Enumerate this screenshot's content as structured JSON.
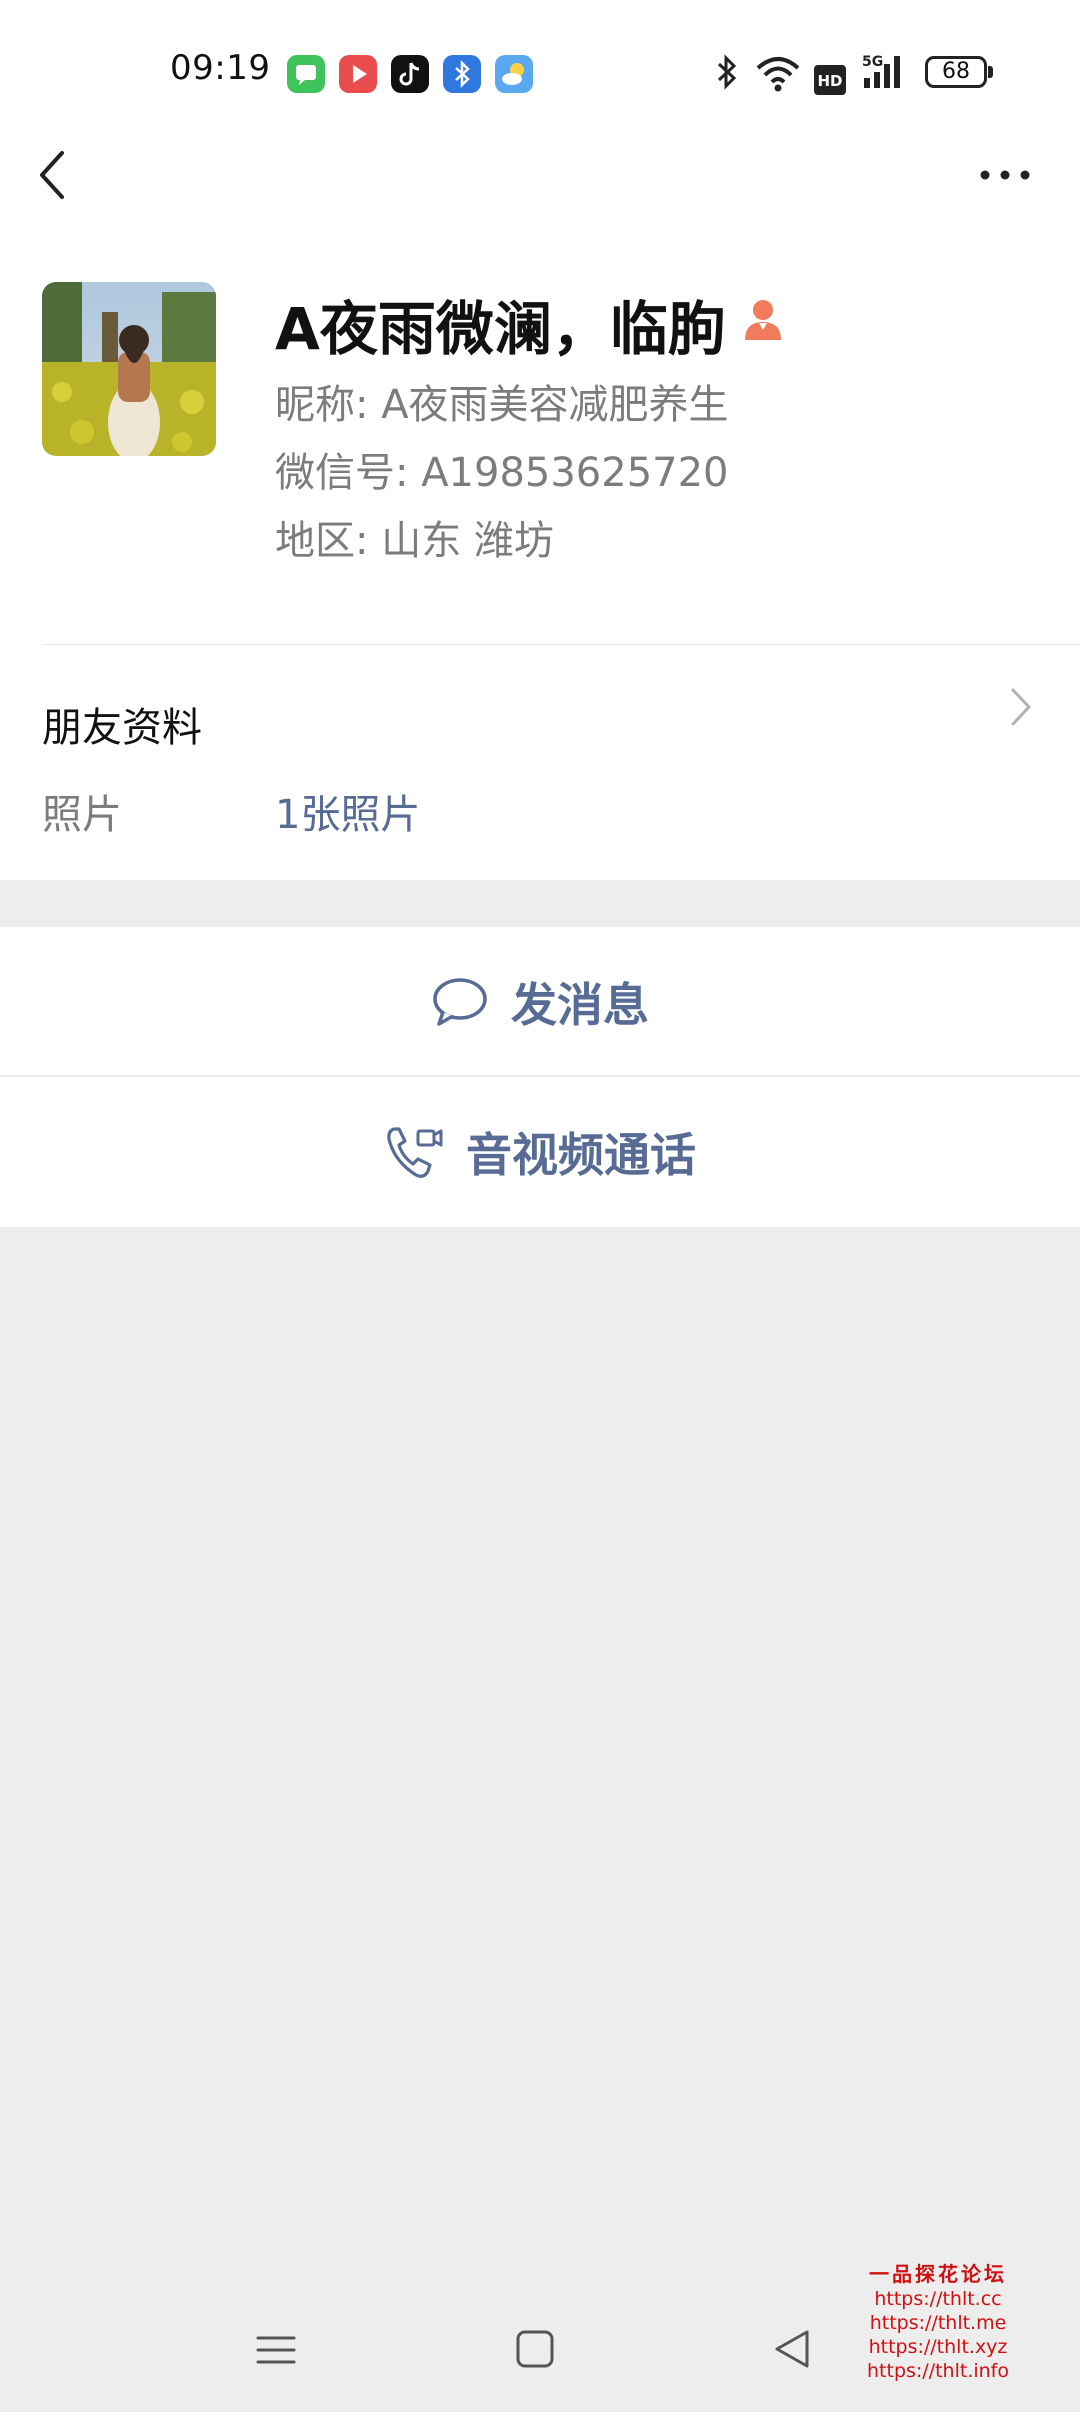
{
  "status_bar": {
    "time": "09:19",
    "battery": "68",
    "icons": [
      "messages-app-icon",
      "video-app-icon",
      "tiktok-icon",
      "bluetooth-app-icon",
      "weather-icon",
      "bluetooth-icon",
      "wifi-icon",
      "hd-icon",
      "5g-signal-icon"
    ]
  },
  "profile": {
    "display_name": "A夜雨微澜，临朐",
    "nickname": "昵称:  A夜雨美容减肥养生",
    "wechat_id": "微信号:  A19853625720",
    "region": "地区:  山东  潍坊"
  },
  "friend_info": {
    "title": "朋友资料",
    "photo_label": "照片",
    "photo_value": "1张照片"
  },
  "actions": {
    "message": "发消息",
    "call": "音视频通话"
  },
  "watermark": {
    "title": "一品探花论坛",
    "links": [
      "https://thlt.cc",
      "https://thlt.me",
      "https://thlt.xyz",
      "https://thlt.info"
    ]
  },
  "colors": {
    "link": "#576b95",
    "background": "#ededed",
    "contact_icon": "#f07c5b"
  }
}
